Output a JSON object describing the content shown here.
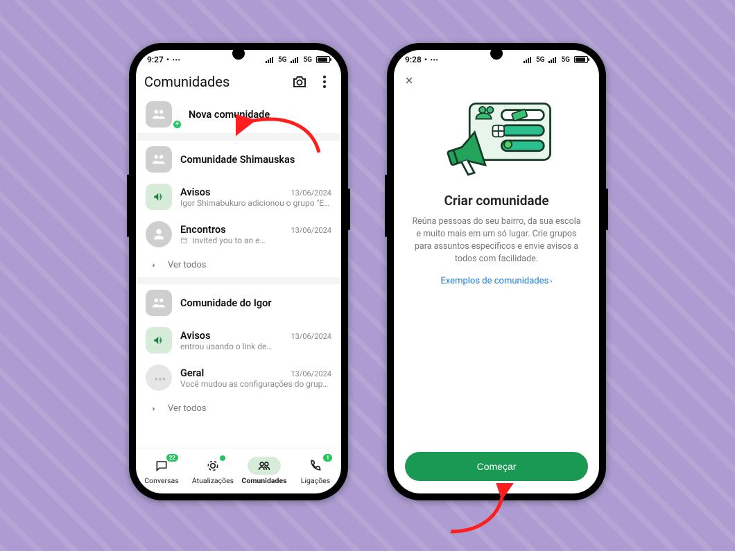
{
  "statusbar": {
    "time_left": "9:27",
    "time_right": "9:28",
    "net": "5G"
  },
  "screen1": {
    "title": "Comunidades",
    "new_label": "Nova comunidade",
    "communities": [
      {
        "name": "Comunidade Shimauskas",
        "items": [
          {
            "kind": "announce",
            "title": "Avisos",
            "date": "13/06/2024",
            "sub": "Igor Shimabukuro adicionou o grupo \"Enco…"
          },
          {
            "kind": "group",
            "title": "Encontros",
            "date": "13/06/2024",
            "sub": "invited you to an e…",
            "calendar_icon": true
          }
        ]
      },
      {
        "name": "Comunidade do Igor",
        "items": [
          {
            "kind": "announce",
            "title": "Avisos",
            "date": "13/06/2024",
            "sub": "entrou usando o link de…"
          },
          {
            "kind": "group",
            "title": "Geral",
            "date": "13/06/2024",
            "sub": "Você mudou as configurações do grupo pa…"
          }
        ]
      }
    ],
    "see_all": "Ver todos",
    "tabs": [
      {
        "id": "chats",
        "label": "Conversas",
        "count": "22"
      },
      {
        "id": "updates",
        "label": "Atualizações",
        "dot": true
      },
      {
        "id": "communities",
        "label": "Comunidades",
        "active": true
      },
      {
        "id": "calls",
        "label": "Ligações",
        "count": "1"
      }
    ]
  },
  "screen2": {
    "heading": "Criar comunidade",
    "desc": "Reúna pessoas do seu bairro, da sua escola e muito mais em um só lugar. Crie grupos para assuntos específicos e envie avisos a todos com facilidade.",
    "link": "Exemplos de comunidades",
    "cta": "Começar"
  }
}
